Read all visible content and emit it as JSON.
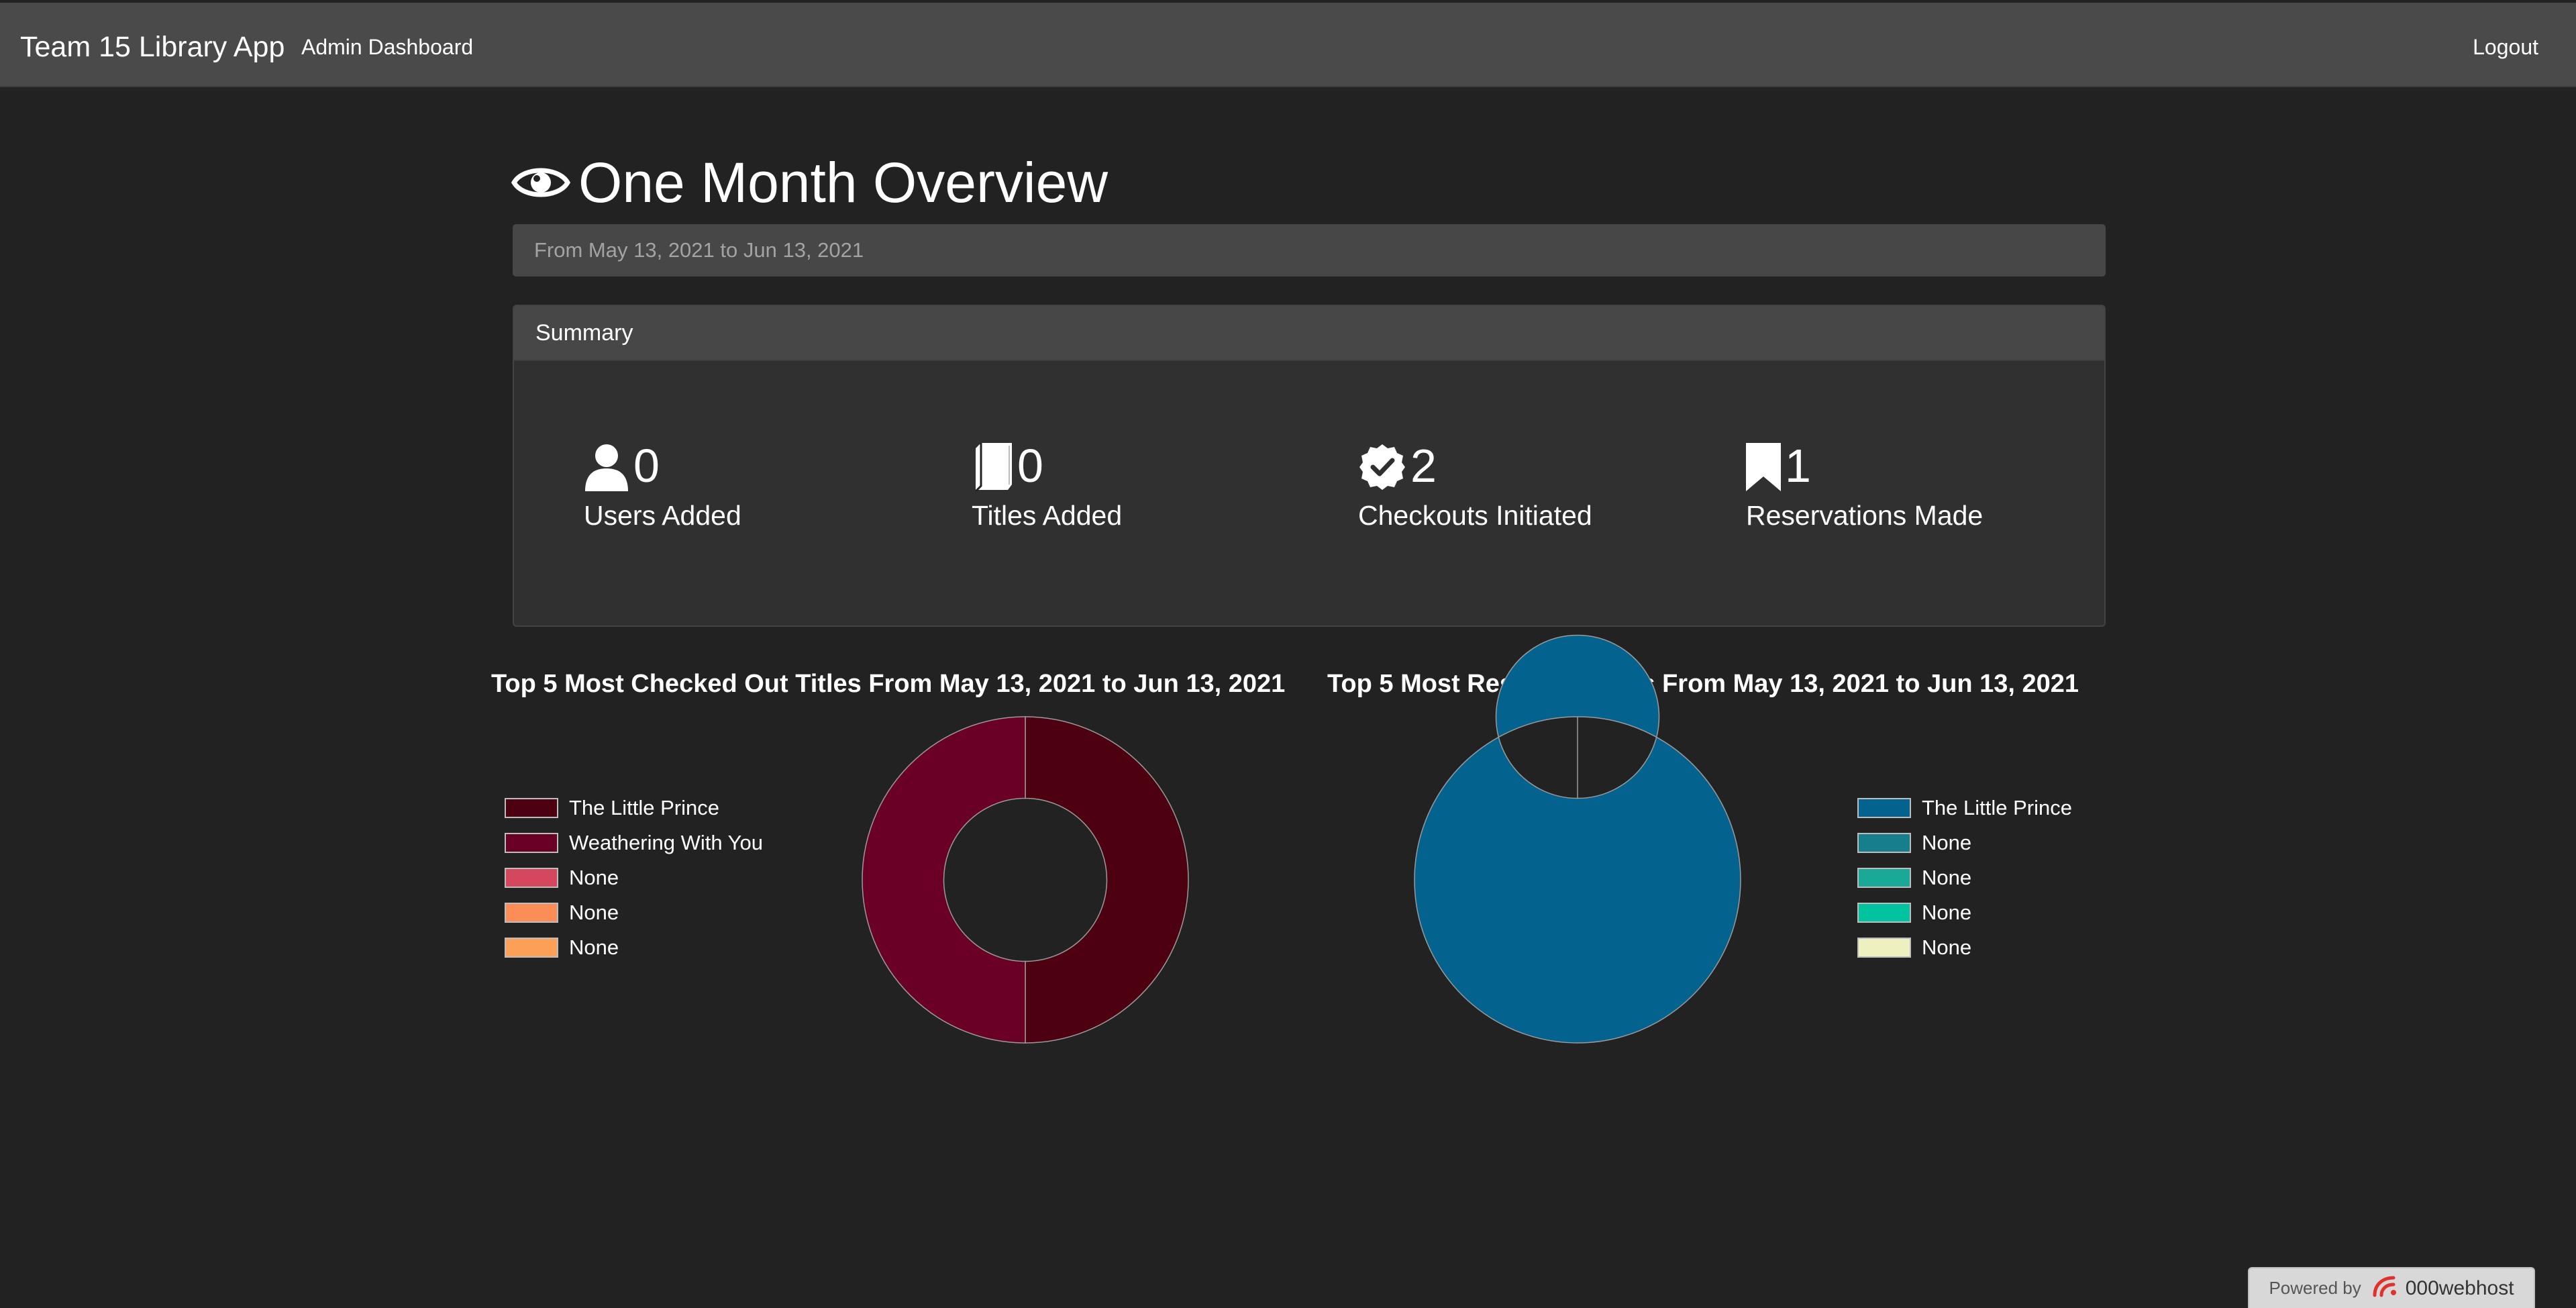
{
  "navbar": {
    "brand": "Team 15 Library App",
    "admin_link": "Admin Dashboard",
    "logout": "Logout"
  },
  "header": {
    "icon": "eye-icon",
    "title": "One Month Overview",
    "date_range": "From May 13, 2021 to Jun 13, 2021"
  },
  "summary": {
    "heading": "Summary",
    "stats": [
      {
        "icon": "user-icon",
        "value": "0",
        "label": "Users Added"
      },
      {
        "icon": "book-icon",
        "value": "0",
        "label": "Titles Added"
      },
      {
        "icon": "check-badge-icon",
        "value": "2",
        "label": "Checkouts Initiated"
      },
      {
        "icon": "bookmark-icon",
        "value": "1",
        "label": "Reservations Made"
      }
    ]
  },
  "chart_data": [
    {
      "type": "pie",
      "title": "Top 5 Most Checked Out Titles From May 13, 2021 to Jun 13, 2021",
      "legend_position": "left",
      "hole": 0.5,
      "labels": [
        "The Little Prince",
        "Weathering With You",
        "None",
        "None",
        "None"
      ],
      "values": [
        1,
        1,
        0,
        0,
        0
      ],
      "colors": [
        "#4d000f",
        "#6a0026",
        "#d4475c",
        "#fc8c58",
        "#fca057"
      ]
    },
    {
      "type": "pie",
      "title": "Top 5 Most Reserved Titles From May 13, 2021 to Jun 13, 2021",
      "legend_position": "right",
      "hole": 0.5,
      "labels": [
        "The Little Prince",
        "None",
        "None",
        "None",
        "None"
      ],
      "values": [
        1,
        0,
        0,
        0,
        0
      ],
      "colors": [
        "#04628f",
        "#167e8c",
        "#1aa997",
        "#00c49f",
        "#eef1bf"
      ]
    }
  ],
  "footer": {
    "powered_by": "Powered by",
    "host": "000webhost"
  }
}
